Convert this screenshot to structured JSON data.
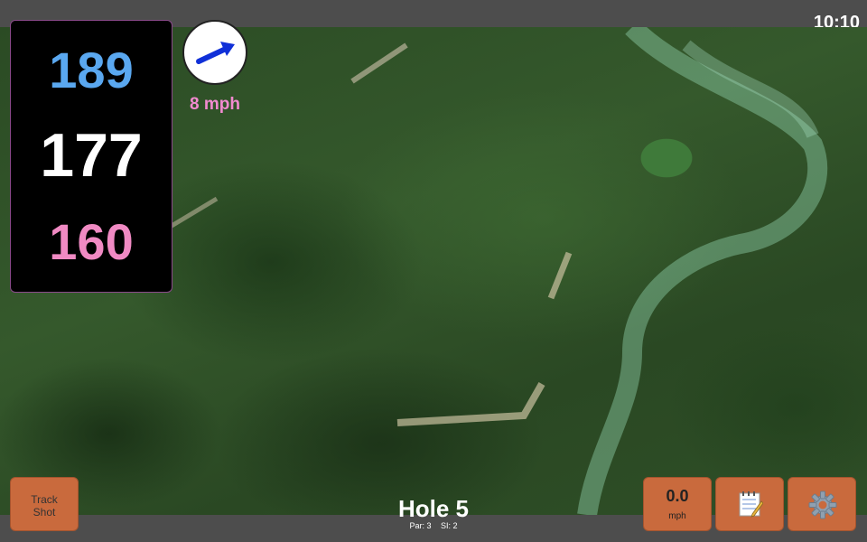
{
  "status_bar": {
    "time": "10:10"
  },
  "distances": {
    "back": "189",
    "middle": "177",
    "front": "160"
  },
  "wind": {
    "speed": "8 mph",
    "direction_icon": "arrow-up-right"
  },
  "buttons": {
    "track_shot": {
      "line1": "Track",
      "line2": "Shot"
    },
    "speed": {
      "value": "0.0",
      "unit": "mph"
    },
    "notes_icon": "notepad-icon",
    "settings_icon": "gear-icon"
  },
  "hole": {
    "title": "Hole 5",
    "par": "Par: 3",
    "si": "SI: 2"
  },
  "colors": {
    "back": "#5aa8f0",
    "middle": "#ffffff",
    "front": "#f08ac3",
    "wind_text": "#f28ad0",
    "button": "#c96a3d"
  }
}
